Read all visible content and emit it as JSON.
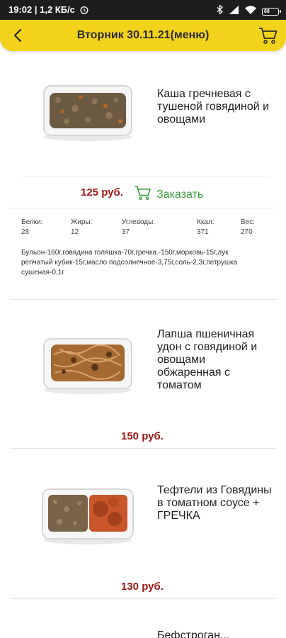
{
  "status": {
    "time": "19:02 | 1,2 КБ/с",
    "battery": "88"
  },
  "header": {
    "title": "Вторник 30.11.21(меню)"
  },
  "items": [
    {
      "name": "Каша гречневая с тушеной говядиной и овощами",
      "price": "125 руб.",
      "order_label": "Заказать",
      "nutrition": {
        "protein_label": "Белки:",
        "protein": "28",
        "fat_label": "Жиры:",
        "fat": "12",
        "carbs_label": "Углеводы:",
        "carbs": "37",
        "kcal_label": "Ккал:",
        "kcal": "371",
        "weight_label": "Вес:",
        "weight": "270"
      },
      "composition": "Бульон-160г,говядина голяшка-70г,гречка.-150г,морковь-15г,лук репчатый кубик-15г,масло подсолнечное-3,75г,соль-2,3г,петрушка сушеная-0,1г"
    },
    {
      "name": "Лапша пшеничная удон с говядиной и овощами обжаренная с томатом",
      "price": "150 руб."
    },
    {
      "name": "Тефтели из Говядины в томатном соусе + ГРЕЧКА",
      "price": "130 руб."
    },
    {
      "name": "Бефстроган..."
    }
  ],
  "colors": {
    "header_bg": "#f2d21a",
    "price": "#a01818",
    "order": "#3a9d3a"
  }
}
